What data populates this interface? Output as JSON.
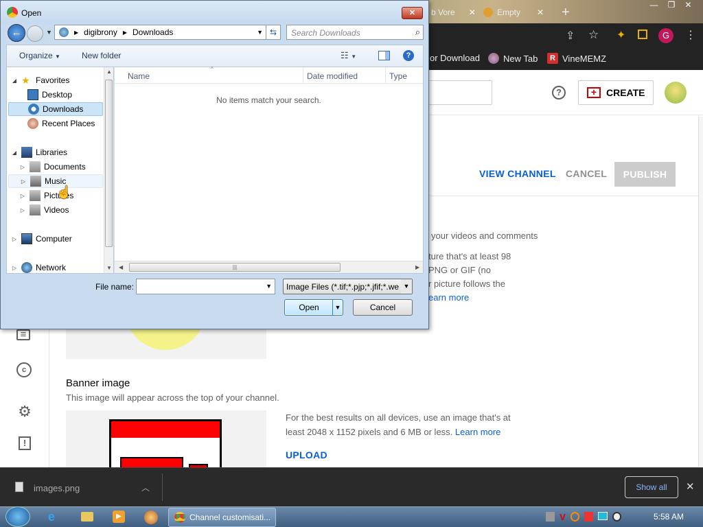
{
  "browser": {
    "tabs": [
      {
        "label": "b Vore"
      },
      {
        "label": "Empty"
      }
    ],
    "new_tab_symbol": "+",
    "profile_initial": "G",
    "bookmarks": [
      {
        "label": "or Download"
      },
      {
        "label": "New Tab"
      },
      {
        "label": "VineMEMZ"
      }
    ]
  },
  "youtube": {
    "help_symbol": "?",
    "create_label": "CREATE",
    "view_channel_label": "VIEW CHANNEL",
    "cancel_label": "CANCEL",
    "publish_label": "PUBLISH",
    "picture_lines": [
      "your videos and comments",
      "ture that's at least 98",
      "PNG or GIF (no",
      "r picture follows the",
      "earn more"
    ],
    "banner": {
      "title": "Banner image",
      "subtitle": "This image will appear across the top of your channel.",
      "desc_line1": "For the best results on all devices, use an image that's at",
      "desc_line2": "least 2048 x 1152 pixels and 6 MB or less.",
      "learn_more": "Learn more",
      "upload_label": "UPLOAD"
    },
    "sidebar_icons": [
      "subtitles-icon",
      "copyright-icon",
      "settings-icon",
      "feedback-icon"
    ]
  },
  "download_bar": {
    "file_name": "images.png",
    "show_all_label": "Show all"
  },
  "taskbar": {
    "active_window": "Channel customisati...",
    "time": "5:58 AM"
  },
  "dialog": {
    "title": "Open",
    "breadcrumb": [
      "digibrony",
      "Downloads"
    ],
    "search_placeholder": "Search Downloads",
    "organize_label": "Organize",
    "new_folder_label": "New folder",
    "nav_tree": {
      "favorites": "Favorites",
      "favorites_items": [
        "Desktop",
        "Downloads",
        "Recent Places"
      ],
      "libraries": "Libraries",
      "libraries_items": [
        "Documents",
        "Music",
        "Pictures",
        "Videos"
      ],
      "computer": "Computer",
      "network": "Network"
    },
    "columns": [
      "Name",
      "Date modified",
      "Type"
    ],
    "empty_message": "No items match your search.",
    "file_name_label": "File name:",
    "file_name_value": "",
    "file_type_value": "Image Files (*.tif;*.pjp;*.jfif;*.we",
    "open_label": "Open",
    "cancel_label": "Cancel"
  }
}
